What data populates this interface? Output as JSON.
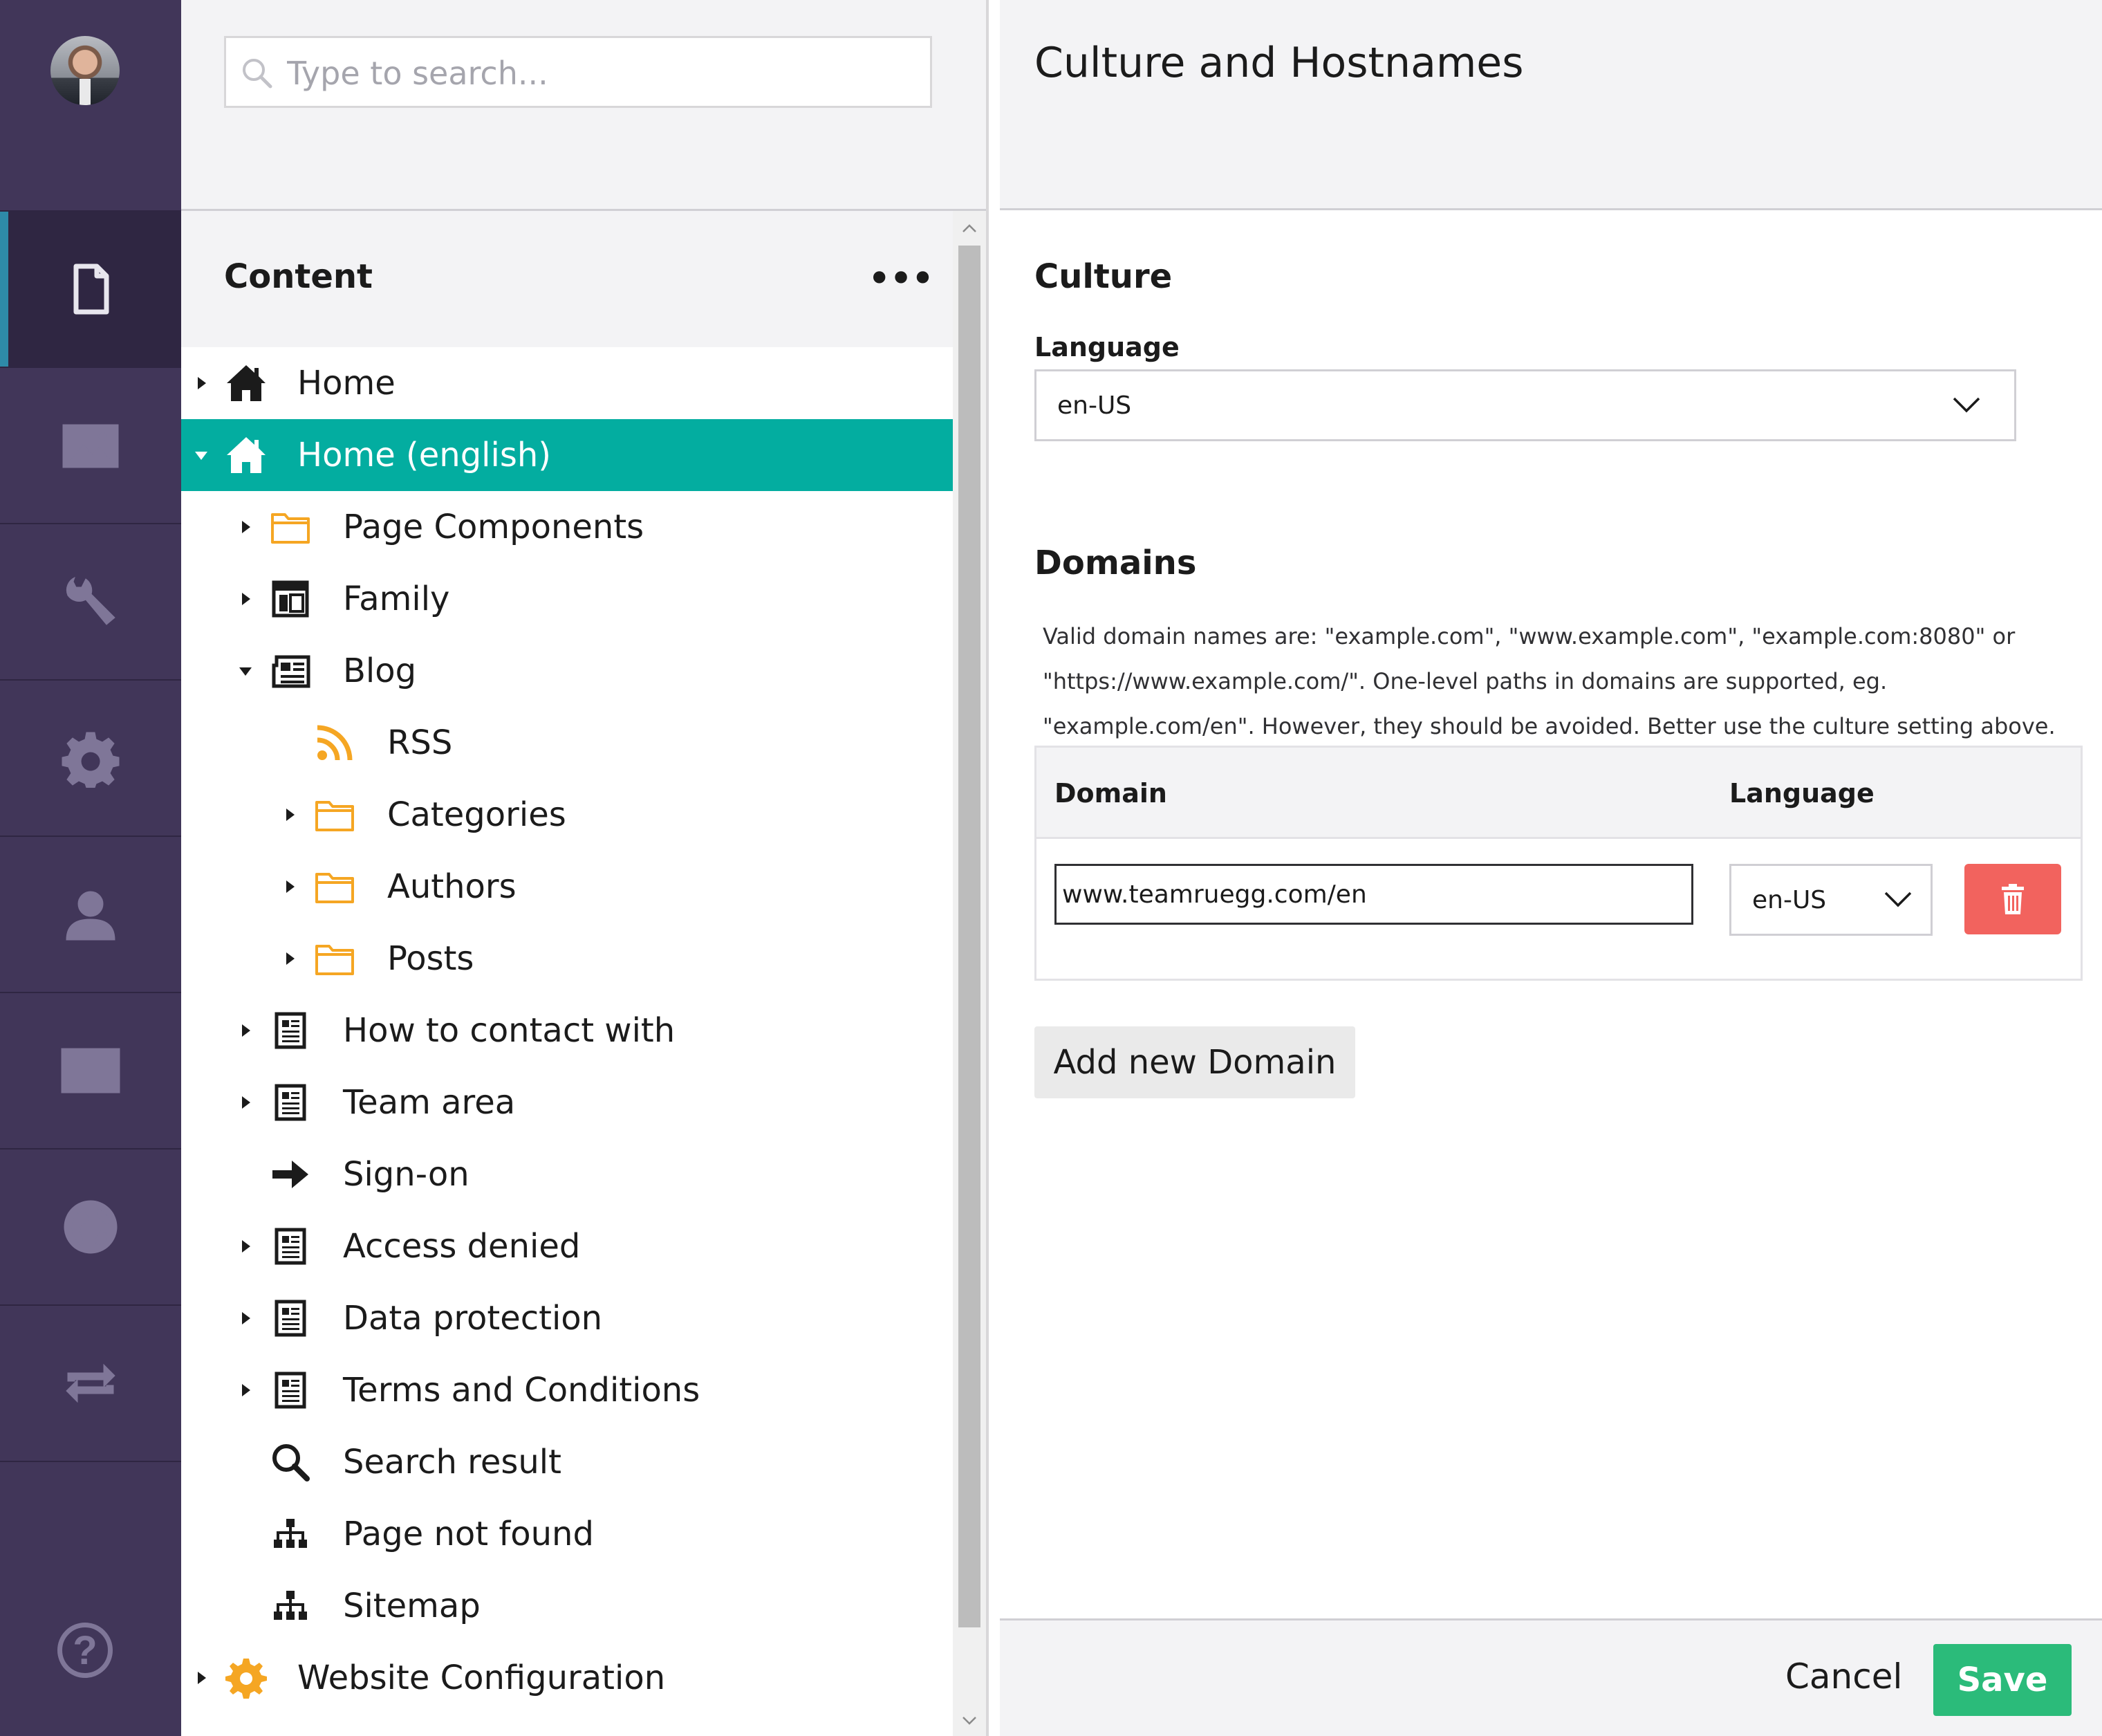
{
  "search": {
    "placeholder": "Type to search..."
  },
  "tree": {
    "title": "Content",
    "more": "•••",
    "items": [
      {
        "label": "Home",
        "icon": "home-icon",
        "expanded": false
      },
      {
        "label": "Home (english)",
        "icon": "home-icon",
        "expanded": true,
        "selected": true
      },
      {
        "label": "Page Components",
        "icon": "folder-icon"
      },
      {
        "label": "Family",
        "icon": "layout-icon"
      },
      {
        "label": "Blog",
        "icon": "newspaper-icon",
        "expanded": true
      },
      {
        "label": "RSS",
        "icon": "rss-icon"
      },
      {
        "label": "Categories",
        "icon": "folder-icon"
      },
      {
        "label": "Authors",
        "icon": "folder-icon"
      },
      {
        "label": "Posts",
        "icon": "folder-icon"
      },
      {
        "label": "How to contact with",
        "icon": "document-icon"
      },
      {
        "label": "Team area",
        "icon": "document-icon"
      },
      {
        "label": "Sign-on",
        "icon": "arrow-right-icon"
      },
      {
        "label": "Access denied",
        "icon": "document-icon"
      },
      {
        "label": "Data protection",
        "icon": "document-icon"
      },
      {
        "label": "Terms and Conditions",
        "icon": "document-icon"
      },
      {
        "label": "Search result",
        "icon": "search-icon"
      },
      {
        "label": "Page not found",
        "icon": "sitemap-icon"
      },
      {
        "label": "Sitemap",
        "icon": "sitemap-icon"
      },
      {
        "label": "Website Configuration",
        "icon": "gear-icon"
      }
    ]
  },
  "nav": {
    "items": [
      "content",
      "media",
      "settings",
      "developer",
      "users",
      "members",
      "translation",
      "forms"
    ],
    "help": "?"
  },
  "editor": {
    "title": "Culture and Hostnames",
    "culture_heading": "Culture",
    "language_label": "Language",
    "language_value": "en-US",
    "domains_heading": "Domains",
    "domains_help": "Valid domain names are: \"example.com\", \"www.example.com\", \"example.com:8080\" or \"https://www.example.com/\". One-level paths in domains are supported, eg. \"example.com/en\". However, they should be avoided. Better use the culture setting above.",
    "table": {
      "col_domain": "Domain",
      "col_language": "Language",
      "rows": [
        {
          "domain": "www.teamruegg.com/en",
          "language": "en-US"
        }
      ]
    },
    "add_domain_label": "Add new Domain",
    "cancel_label": "Cancel",
    "save_label": "Save"
  },
  "colors": {
    "nav_bg": "#413659",
    "selected_row": "#03ada0",
    "save_green": "#2bbb7a",
    "delete_red": "#f2635e",
    "folder_orange": "#f5a623"
  }
}
